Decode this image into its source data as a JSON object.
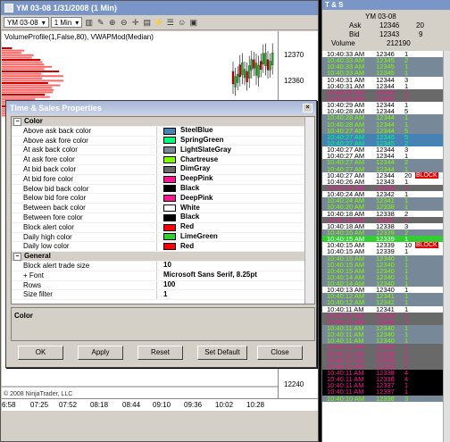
{
  "chart": {
    "title": "YM 03-08  1/31/2008 (1 Min)",
    "toolbar": {
      "instrument": "YM 03-08",
      "interval": "1 Min"
    },
    "indicator": "VolumeProfile(1,False,80), VWAPMod(Median)",
    "price_labels": [
      "12370",
      "12360",
      "12240"
    ],
    "time_labels": [
      "6:58",
      "07:25",
      "07:52",
      "08:18",
      "08:44",
      "09:10",
      "09:36",
      "10:02",
      "10:28"
    ],
    "copyright": "© 2008 NinjaTrader, LLC"
  },
  "dialog": {
    "title": "Time & Sales Properties",
    "close": "×",
    "categories": [
      {
        "name": "Color",
        "toggle": "−",
        "rows": [
          {
            "name": "Above ask back color",
            "value": "SteelBlue",
            "color": "#4682B4"
          },
          {
            "name": "Above ask fore color",
            "value": "SpringGreen",
            "color": "#00FF7F"
          },
          {
            "name": "At ask back color",
            "value": "LightSlateGray",
            "color": "#778899"
          },
          {
            "name": "At ask fore color",
            "value": "Chartreuse",
            "color": "#7FFF00"
          },
          {
            "name": "At bid back color",
            "value": "DimGray",
            "color": "#696969"
          },
          {
            "name": "At bid fore color",
            "value": "DeepPink",
            "color": "#FF1493"
          },
          {
            "name": "Below bid back color",
            "value": "Black",
            "color": "#000000"
          },
          {
            "name": "Below bid fore color",
            "value": "DeepPink",
            "color": "#FF1493"
          },
          {
            "name": "Between back color",
            "value": "White",
            "color": "#FFFFFF"
          },
          {
            "name": "Between fore color",
            "value": "Black",
            "color": "#000000"
          },
          {
            "name": "Block alert color",
            "value": "Red",
            "color": "#FF0000"
          },
          {
            "name": "Daily high color",
            "value": "LimeGreen",
            "color": "#32CD32"
          },
          {
            "name": "Daily low color",
            "value": "Red",
            "color": "#FF0000"
          }
        ]
      },
      {
        "name": "General",
        "toggle": "−",
        "rows": [
          {
            "name": "Block alert trade size",
            "value": "10"
          },
          {
            "name": "Font",
            "value": "Microsoft Sans Serif, 8.25pt",
            "toggle": "+"
          },
          {
            "name": "Rows",
            "value": "100"
          },
          {
            "name": "Size filter",
            "value": "1"
          }
        ]
      }
    ],
    "description_title": "Color",
    "buttons": {
      "ok": "OK",
      "apply": "Apply",
      "reset": "Reset",
      "set_default": "Set Default",
      "close": "Close"
    }
  },
  "ts": {
    "title": "T & S",
    "instrument": "YM 03-08",
    "ask_label": "Ask",
    "ask_price": "12346",
    "ask_size": "20",
    "bid_label": "Bid",
    "bid_price": "12343",
    "bid_size": "9",
    "volume_label": "Volume",
    "volume": "212190",
    "block_label": "BLOCK",
    "rows": [
      {
        "t": "10:40:33 AM",
        "p": "12346",
        "s": "1",
        "bg": "#ffffff",
        "fg": "#000000"
      },
      {
        "t": "10:40:33 AM",
        "p": "12345",
        "s": "2",
        "bg": "#778899",
        "fg": "#7fff00"
      },
      {
        "t": "10:40:33 AM",
        "p": "12345",
        "s": "1",
        "bg": "#778899",
        "fg": "#7fff00"
      },
      {
        "t": "10:40:33 AM",
        "p": "12345",
        "s": "1",
        "bg": "#778899",
        "fg": "#7fff00"
      },
      {
        "t": "10:40:31 AM",
        "p": "12344",
        "s": "3",
        "bg": "#ffffff",
        "fg": "#000000"
      },
      {
        "t": "10:40:31 AM",
        "p": "12344",
        "s": "1",
        "bg": "#ffffff",
        "fg": "#000000"
      },
      {
        "t": "10:40:30 AM",
        "p": "12343",
        "s": "1",
        "bg": "#696969",
        "fg": "#ff1493"
      },
      {
        "t": "10:40:30 AM",
        "p": "12343",
        "s": "1",
        "bg": "#696969",
        "fg": "#ff1493"
      },
      {
        "t": "10:40:29 AM",
        "p": "12344",
        "s": "1",
        "bg": "#ffffff",
        "fg": "#000000"
      },
      {
        "t": "10:40:28 AM",
        "p": "12344",
        "s": "5",
        "bg": "#ffffff",
        "fg": "#000000"
      },
      {
        "t": "10:40:28 AM",
        "p": "12344",
        "s": "1",
        "bg": "#778899",
        "fg": "#7fff00"
      },
      {
        "t": "10:40:28 AM",
        "p": "12344",
        "s": "1",
        "bg": "#778899",
        "fg": "#7fff00"
      },
      {
        "t": "10:40:27 AM",
        "p": "12344",
        "s": "5",
        "bg": "#778899",
        "fg": "#7fff00"
      },
      {
        "t": "10:40:27 AM",
        "p": "12345",
        "s": "5",
        "bg": "#4682b4",
        "fg": "#00ff7f"
      },
      {
        "t": "10:40:27 AM",
        "p": "12345",
        "s": "2",
        "bg": "#4682b4",
        "fg": "#00ff7f"
      },
      {
        "t": "10:40:27 AM",
        "p": "12344",
        "s": "3",
        "bg": "#ffffff",
        "fg": "#000000"
      },
      {
        "t": "10:40:27 AM",
        "p": "12344",
        "s": "1",
        "bg": "#ffffff",
        "fg": "#000000"
      },
      {
        "t": "10:40:27 AM",
        "p": "12344",
        "s": "2",
        "bg": "#778899",
        "fg": "#7fff00"
      },
      {
        "t": "10:40:27 AM",
        "p": "12344",
        "s": "1",
        "bg": "#778899",
        "fg": "#7fff00"
      },
      {
        "t": "10:40:27 AM",
        "p": "12344",
        "s": "20",
        "bg": "#ffffff",
        "fg": "#000000",
        "block": true
      },
      {
        "t": "10:40:26 AM",
        "p": "12343",
        "s": "1",
        "bg": "#ffffff",
        "fg": "#000000"
      },
      {
        "t": "10:40:25 AM",
        "p": "12343",
        "s": "1",
        "bg": "#696969",
        "fg": "#ff1493"
      },
      {
        "t": "10:40:24 AM",
        "p": "12342",
        "s": "1",
        "bg": "#ffffff",
        "fg": "#000000"
      },
      {
        "t": "10:40:24 AM",
        "p": "12341",
        "s": "1",
        "bg": "#778899",
        "fg": "#7fff00"
      },
      {
        "t": "10:40:20 AM",
        "p": "12338",
        "s": "1",
        "bg": "#778899",
        "fg": "#7fff00"
      },
      {
        "t": "10:40:18 AM",
        "p": "12338",
        "s": "2",
        "bg": "#ffffff",
        "fg": "#000000"
      },
      {
        "t": "10:40:18 AM",
        "p": "12337",
        "s": "1",
        "bg": "#696969",
        "fg": "#ff1493"
      },
      {
        "t": "10:40:18 AM",
        "p": "12338",
        "s": "3",
        "bg": "#ffffff",
        "fg": "#000000"
      },
      {
        "t": "10:40:16 AM",
        "p": "12339",
        "s": "2",
        "bg": "#778899",
        "fg": "#7fff00"
      },
      {
        "t": "10:40:15 AM",
        "p": "12339",
        "s": "1",
        "bg": "#32cd32",
        "fg": "#ffffff"
      },
      {
        "t": "10:40:15 AM",
        "p": "12339",
        "s": "10",
        "bg": "#ffffff",
        "fg": "#000000",
        "block": true
      },
      {
        "t": "10:40:15 AM",
        "p": "12339",
        "s": "1",
        "bg": "#ffffff",
        "fg": "#000000"
      },
      {
        "t": "10:40:15 AM",
        "p": "12340",
        "s": "1",
        "bg": "#778899",
        "fg": "#7fff00"
      },
      {
        "t": "10:40:15 AM",
        "p": "12340",
        "s": "1",
        "bg": "#778899",
        "fg": "#7fff00"
      },
      {
        "t": "10:40:15 AM",
        "p": "12340",
        "s": "1",
        "bg": "#778899",
        "fg": "#7fff00"
      },
      {
        "t": "10:40:14 AM",
        "p": "12340",
        "s": "1",
        "bg": "#778899",
        "fg": "#7fff00"
      },
      {
        "t": "10:40:14 AM",
        "p": "12340",
        "s": "1",
        "bg": "#778899",
        "fg": "#7fff00"
      },
      {
        "t": "10:40:13 AM",
        "p": "12340",
        "s": "1",
        "bg": "#ffffff",
        "fg": "#000000"
      },
      {
        "t": "10:40:12 AM",
        "p": "12341",
        "s": "1",
        "bg": "#778899",
        "fg": "#7fff00"
      },
      {
        "t": "10:40:12 AM",
        "p": "12342",
        "s": "1",
        "bg": "#778899",
        "fg": "#7fff00"
      },
      {
        "t": "10:40:11 AM",
        "p": "12341",
        "s": "1",
        "bg": "#ffffff",
        "fg": "#000000"
      },
      {
        "t": "10:40:11 AM",
        "p": "12340",
        "s": "1",
        "bg": "#696969",
        "fg": "#ff1493"
      },
      {
        "t": "10:40:11 AM",
        "p": "12340",
        "s": "1",
        "bg": "#696969",
        "fg": "#ff1493"
      },
      {
        "t": "10:40:11 AM",
        "p": "12340",
        "s": "1",
        "bg": "#778899",
        "fg": "#7fff00"
      },
      {
        "t": "10:40:11 AM",
        "p": "12340",
        "s": "1",
        "bg": "#778899",
        "fg": "#7fff00"
      },
      {
        "t": "10:40:11 AM",
        "p": "12340",
        "s": "1",
        "bg": "#778899",
        "fg": "#7fff00"
      },
      {
        "t": "10:40:11 AM",
        "p": "12339",
        "s": "1",
        "bg": "#696969",
        "fg": "#ff1493"
      },
      {
        "t": "10:40:11 AM",
        "p": "12339",
        "s": "1",
        "bg": "#696969",
        "fg": "#ff1493"
      },
      {
        "t": "10:40:11 AM",
        "p": "12339",
        "s": "2",
        "bg": "#696969",
        "fg": "#ff1493"
      },
      {
        "t": "10:40:11 AM",
        "p": "12339",
        "s": "1",
        "bg": "#696969",
        "fg": "#ff1493"
      },
      {
        "t": "10:40:11 AM",
        "p": "12338",
        "s": "4",
        "bg": "#000000",
        "fg": "#ff1493"
      },
      {
        "t": "10:40:11 AM",
        "p": "12338",
        "s": "4",
        "bg": "#000000",
        "fg": "#ff1493"
      },
      {
        "t": "10:40:11 AM",
        "p": "12337",
        "s": "1",
        "bg": "#000000",
        "fg": "#ff1493"
      },
      {
        "t": "10:40:11 AM",
        "p": "12337",
        "s": "1",
        "bg": "#000000",
        "fg": "#ff1493"
      },
      {
        "t": "10:40:10 AM",
        "p": "12338",
        "s": "3",
        "bg": "#778899",
        "fg": "#7fff00"
      }
    ]
  }
}
